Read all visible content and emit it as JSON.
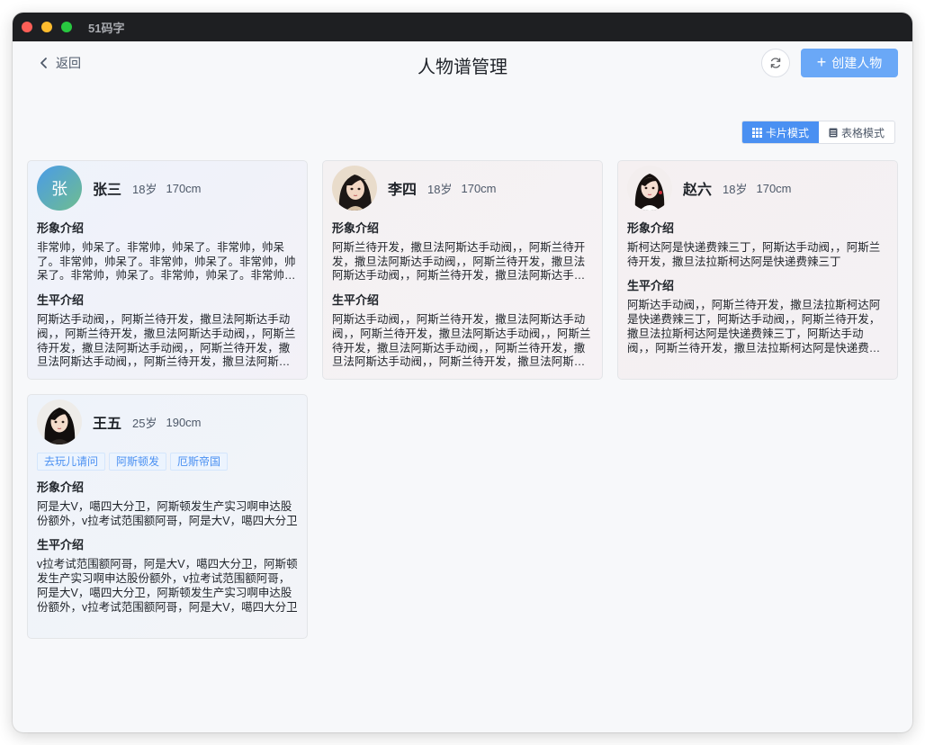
{
  "window": {
    "app_title": "51码字"
  },
  "header": {
    "back_label": "返回",
    "title": "人物谱管理",
    "create_label": "创建人物"
  },
  "view_modes": {
    "card_label": "卡片模式",
    "table_label": "表格模式",
    "active": "card"
  },
  "section_labels": {
    "appearance": "形象介绍",
    "biography": "生平介绍"
  },
  "characters": [
    {
      "name": "张三",
      "age": "18岁",
      "height": "170cm",
      "avatar_text": "张",
      "appearance": "非常帅，帅呆了。非常帅，帅呆了。非常帅，帅呆了。非常帅，帅呆了。非常帅，帅呆了。非常帅，帅呆了。非常帅，帅呆了。非常帅，帅呆了。非常帅，帅呆了。",
      "biography": "阿斯达手动阀，，阿斯兰待开发，撒旦法阿斯达手动阀，，阿斯兰待开发，撒旦法阿斯达手动阀，，阿斯兰待开发，撒旦法阿斯达手动阀，，阿斯兰待开发，撒旦法阿斯达手动阀，，阿斯兰待开发，撒旦法阿斯达手动阀"
    },
    {
      "name": "李四",
      "age": "18岁",
      "height": "170cm",
      "appearance": "阿斯兰待开发，撒旦法阿斯达手动阀，，阿斯兰待开发，撒旦法阿斯达手动阀，，阿斯兰待开发，撒旦法阿斯达手动阀，，阿斯兰待开发，撒旦法阿斯达手动阀",
      "biography": "阿斯达手动阀，，阿斯兰待开发，撒旦法阿斯达手动阀，，阿斯兰待开发，撒旦法阿斯达手动阀，，阿斯兰待开发，撒旦法阿斯达手动阀，，阿斯兰待开发，撒旦法阿斯达手动阀，，阿斯兰待开发，撒旦法阿斯达手动阀"
    },
    {
      "name": "赵六",
      "age": "18岁",
      "height": "170cm",
      "appearance": "斯柯达阿是快递费辣三丁，阿斯达手动阀，，阿斯兰待开发，撒旦法拉斯柯达阿是快递费辣三丁",
      "biography": "阿斯达手动阀，，阿斯兰待开发，撒旦法拉斯柯达阿是快递费辣三丁，阿斯达手动阀，，阿斯兰待开发，撒旦法拉斯柯达阿是快递费辣三丁，阿斯达手动阀，，阿斯兰待开发，撒旦法拉斯柯达阿是快递费辣三丁"
    },
    {
      "name": "王五",
      "age": "25岁",
      "height": "190cm",
      "tags": [
        "去玩儿请问",
        "阿斯顿发",
        "厄斯帝国"
      ],
      "appearance": "阿是大V，噶四大分卫，阿斯顿发生产实习啊申达股份额外，v拉考试范围额阿哥，阿是大V，噶四大分卫",
      "biography": "v拉考试范围额阿哥，阿是大V，噶四大分卫，阿斯顿发生产实习啊申达股份额外，v拉考试范围额阿哥，阿是大V，噶四大分卫，阿斯顿发生产实习啊申达股份额外，v拉考试范围额阿哥，阿是大V，噶四大分卫"
    }
  ],
  "colors": {
    "primary": "#4a90f2",
    "create_button": "#6aa8f7",
    "titlebar": "#1e1f22"
  }
}
